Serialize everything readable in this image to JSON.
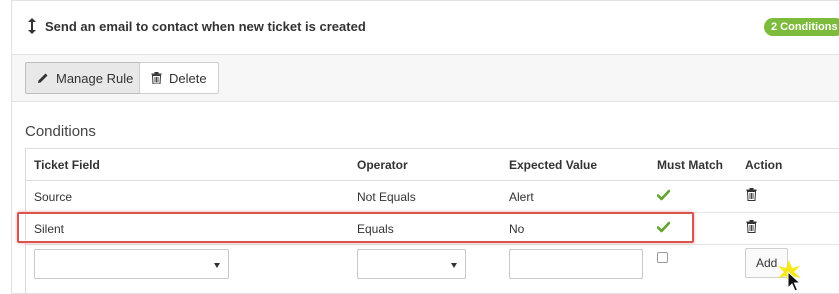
{
  "rule": {
    "title": "Send an email to contact when new ticket is created",
    "badge": "2 Conditions"
  },
  "toolbar": {
    "manage_label": "Manage Rule",
    "delete_label": "Delete"
  },
  "conditions": {
    "title": "Conditions",
    "columns": [
      "Ticket Field",
      "Operator",
      "Expected Value",
      "Must Match",
      "Action"
    ],
    "rows": [
      {
        "field": "Source",
        "operator": "Not Equals",
        "value": "Alert",
        "must_match": true
      },
      {
        "field": "Silent",
        "operator": "Equals",
        "value": "No",
        "must_match": true
      }
    ],
    "new_row": {
      "field_value": "",
      "operator_value": "",
      "expected_value": "",
      "must_match": false,
      "add_label": "Add"
    }
  },
  "colors": {
    "accent_green": "#7dbb3c",
    "highlight_red": "#d9534f",
    "check_green": "#5fa62c"
  },
  "icons": [
    "move-vertical-icon",
    "pencil-icon",
    "trash-icon",
    "checkmark-icon",
    "chevron-down-icon",
    "cursor-icon"
  ]
}
